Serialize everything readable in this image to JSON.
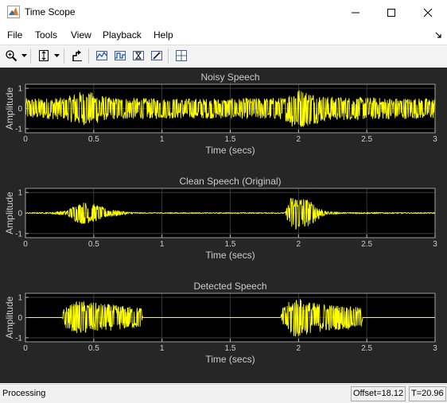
{
  "window": {
    "title": "Time Scope"
  },
  "menu": {
    "items": [
      "File",
      "Tools",
      "View",
      "Playback",
      "Help"
    ]
  },
  "toolbar": {
    "buttons": [
      "zoom-in-icon",
      "scale-axes-icon",
      "restore-view-icon",
      "signal-statistics-icon",
      "peak-finder-icon",
      "bilevel-measurements-icon",
      "triggers-icon",
      "style-icon",
      "layout-icon"
    ]
  },
  "colors": {
    "plot_bg": "#000000",
    "figure_bg": "#262626",
    "trace": "#ffff00",
    "axis_text": "#cccccc"
  },
  "chart_data": [
    {
      "type": "line",
      "title": "Noisy Speech",
      "xlabel": "Time (secs)",
      "ylabel": "Amplitude",
      "xlim": [
        0,
        3
      ],
      "ylim": [
        -1.2,
        1.2
      ],
      "xticks": [
        "0",
        "0.5",
        "1",
        "1.5",
        "2",
        "2.5",
        "3"
      ],
      "yticks": [
        "1",
        "0",
        "-1"
      ],
      "grid": true,
      "series": [
        {
          "envelope": [
            {
              "t": 0.0,
              "a": 0.5
            },
            {
              "t": 0.3,
              "a": 0.55
            },
            {
              "t": 0.38,
              "a": 0.85
            },
            {
              "t": 0.5,
              "a": 0.8
            },
            {
              "t": 0.6,
              "a": 0.55
            },
            {
              "t": 1.0,
              "a": 0.5
            },
            {
              "t": 1.5,
              "a": 0.5
            },
            {
              "t": 1.9,
              "a": 0.55
            },
            {
              "t": 1.97,
              "a": 1.05
            },
            {
              "t": 2.05,
              "a": 0.9
            },
            {
              "t": 2.2,
              "a": 0.6
            },
            {
              "t": 2.5,
              "a": 0.55
            },
            {
              "t": 3.0,
              "a": 0.5
            }
          ]
        }
      ]
    },
    {
      "type": "line",
      "title": "Clean Speech (Original)",
      "xlabel": "Time (secs)",
      "ylabel": "Amplitude",
      "xlim": [
        0,
        3
      ],
      "ylim": [
        -1.2,
        1.2
      ],
      "xticks": [
        "0",
        "0.5",
        "1",
        "1.5",
        "2",
        "2.5",
        "3"
      ],
      "yticks": [
        "1",
        "0",
        "-1"
      ],
      "grid": true,
      "series": [
        {
          "envelope": [
            {
              "t": 0.0,
              "a": 0.02
            },
            {
              "t": 0.18,
              "a": 0.03
            },
            {
              "t": 0.25,
              "a": 0.1
            },
            {
              "t": 0.3,
              "a": 0.1
            },
            {
              "t": 0.36,
              "a": 0.4
            },
            {
              "t": 0.42,
              "a": 0.55
            },
            {
              "t": 0.5,
              "a": 0.45
            },
            {
              "t": 0.6,
              "a": 0.2
            },
            {
              "t": 0.75,
              "a": 0.05
            },
            {
              "t": 0.85,
              "a": 0.02
            },
            {
              "t": 1.9,
              "a": 0.02
            },
            {
              "t": 1.95,
              "a": 0.9
            },
            {
              "t": 2.05,
              "a": 0.75
            },
            {
              "t": 2.15,
              "a": 0.3
            },
            {
              "t": 2.2,
              "a": 0.08
            },
            {
              "t": 2.3,
              "a": 0.03
            },
            {
              "t": 3.0,
              "a": 0.02
            }
          ]
        }
      ]
    },
    {
      "type": "line",
      "title": "Detected Speech",
      "xlabel": "Time (secs)",
      "ylabel": "Amplitude",
      "xlim": [
        0,
        3
      ],
      "ylim": [
        -1.2,
        1.2
      ],
      "xticks": [
        "0",
        "0.5",
        "1",
        "1.5",
        "2",
        "2.5",
        "3"
      ],
      "yticks": [
        "1",
        "0",
        "-1"
      ],
      "grid": true,
      "series": [
        {
          "envelope": [
            {
              "t": 0.0,
              "a": 0
            },
            {
              "t": 0.27,
              "a": 0
            },
            {
              "t": 0.28,
              "a": 0.5
            },
            {
              "t": 0.4,
              "a": 0.85
            },
            {
              "t": 0.55,
              "a": 0.7
            },
            {
              "t": 0.85,
              "a": 0.5
            },
            {
              "t": 0.86,
              "a": 0
            },
            {
              "t": 1.87,
              "a": 0
            },
            {
              "t": 1.88,
              "a": 0.45
            },
            {
              "t": 1.97,
              "a": 1.05
            },
            {
              "t": 2.1,
              "a": 0.75
            },
            {
              "t": 2.46,
              "a": 0.5
            },
            {
              "t": 2.47,
              "a": 0
            },
            {
              "t": 3.0,
              "a": 0
            }
          ]
        }
      ]
    }
  ],
  "status": {
    "text": "Processing",
    "offset": "Offset=18.12",
    "time": "T=20.96"
  }
}
